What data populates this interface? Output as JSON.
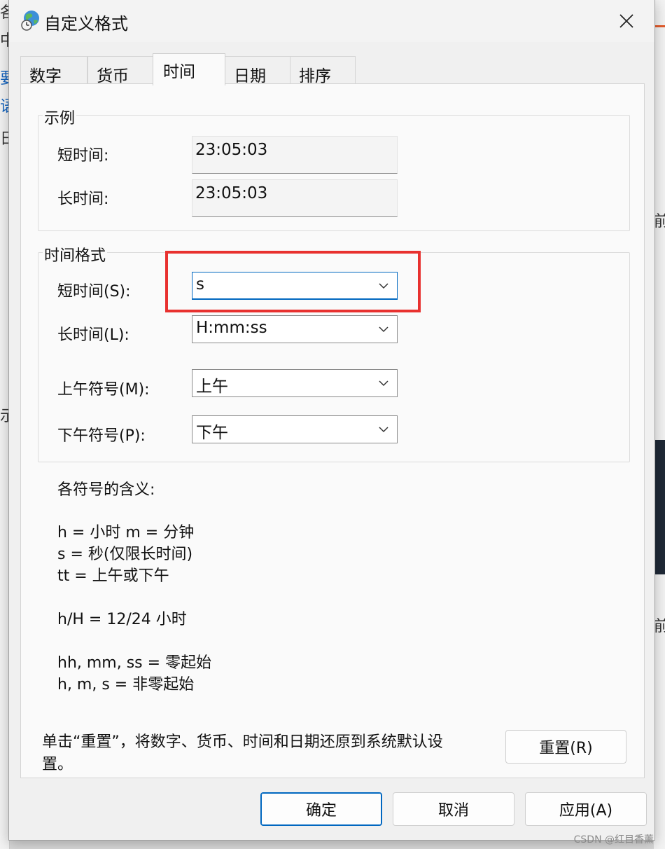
{
  "window": {
    "title": "自定义格式"
  },
  "tabs": [
    {
      "label": "数字"
    },
    {
      "label": "货币"
    },
    {
      "label": "时间"
    },
    {
      "label": "日期"
    },
    {
      "label": "排序"
    }
  ],
  "example": {
    "title": "示例",
    "short_label": "短时间:",
    "short_value": "23:05:03",
    "long_label": "长时间:",
    "long_value": "23:05:03"
  },
  "format": {
    "title": "时间格式",
    "short_label": "短时间(S):",
    "short_value": "s",
    "long_label": "长时间(L):",
    "long_value": "H:mm:ss",
    "am_label": "上午符号(M):",
    "am_value": "上午",
    "pm_label": "下午符号(P):",
    "pm_value": "下午"
  },
  "legend": {
    "heading": "各符号的含义:",
    "lines": [
      "h = 小时   m = 分钟",
      "s = 秒(仅限长时间)",
      "tt = 上午或下午",
      "h/H = 12/24 小时",
      "hh, mm, ss = 零起始",
      "h, m, s = 非零起始"
    ]
  },
  "reset": {
    "text_line1": "单击“重置”，将数字、货币、时间和日期还原到系统默认设",
    "text_line2": "置。",
    "button": "重置(R)"
  },
  "footer": {
    "ok": "确定",
    "cancel": "取消",
    "apply": "应用(A)"
  },
  "background": {
    "left_fragments": [
      "各",
      "中",
      "要",
      "语",
      "日",
      "示"
    ],
    "right_fragments": [
      "前",
      "前"
    ]
  },
  "watermark": "CSDN @红目香薰",
  "colors": {
    "accent": "#0067c0",
    "highlight": "#e8312f",
    "dialog_bg": "#f0f0f0"
  },
  "icons": {
    "title": "globe-clock-icon",
    "close": "close-icon",
    "dropdown": "chevron-down-icon"
  }
}
